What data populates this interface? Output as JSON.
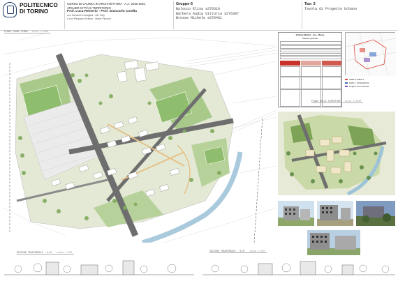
{
  "header": {
    "university": "POLITECNICO DI TORINO",
    "course_line": "CORSO DI LAUREA IN ARCHITETTURA - A.A. 2020-2021",
    "atelier": "ATELIER CITTÀ E TERRITORIO",
    "professors": "Prof. Luca Reinerio - Prof. Giancarlo Cotella",
    "tutors_1": "con Giovanni Caragiani - Ale Tofly",
    "tutors_2": "e con Pierpaolo Fratino - Maria Piccioni",
    "group_title": "Gruppo 6",
    "members": [
      "Balocco Elisa s276319",
      "Barbera Audia Vittoria s276397",
      "Brosse Michele s276461"
    ],
    "tav_title": "Tav: 2",
    "tav_subtitle": "Tavola di Progetto Urbano"
  },
  "tags": {
    "plan": "PIANO PIANO TERRA",
    "plan_scale": "scala 1:1000",
    "aerial": "PIANO DELLE COPERTURE",
    "aerial_scale": "scala 1:2500",
    "section_1": "SEZIONE TRASVERSALE - A-A'",
    "section_1_scale": "scala 1:500",
    "section_2": "SEZIONE TRASVERSALE - B-B'",
    "section_2_scale": "scala 1:500"
  },
  "table": {
    "title": "Schema Obiettivi - Assi - Misure",
    "subtitle": "Obiettivo generale"
  },
  "legend": [
    "ABBATTIMENTI",
    "NUOVI INTERVENTI",
    "RIQUALIFICAZIONI"
  ],
  "colors": {
    "accent_red": "#c8322b",
    "legend": [
      "#d94a3a",
      "#3b6fc4",
      "#7a4bb5"
    ],
    "grass": "#b7d19a",
    "road": "#6e6e6e",
    "water": "#a9c9dd"
  }
}
